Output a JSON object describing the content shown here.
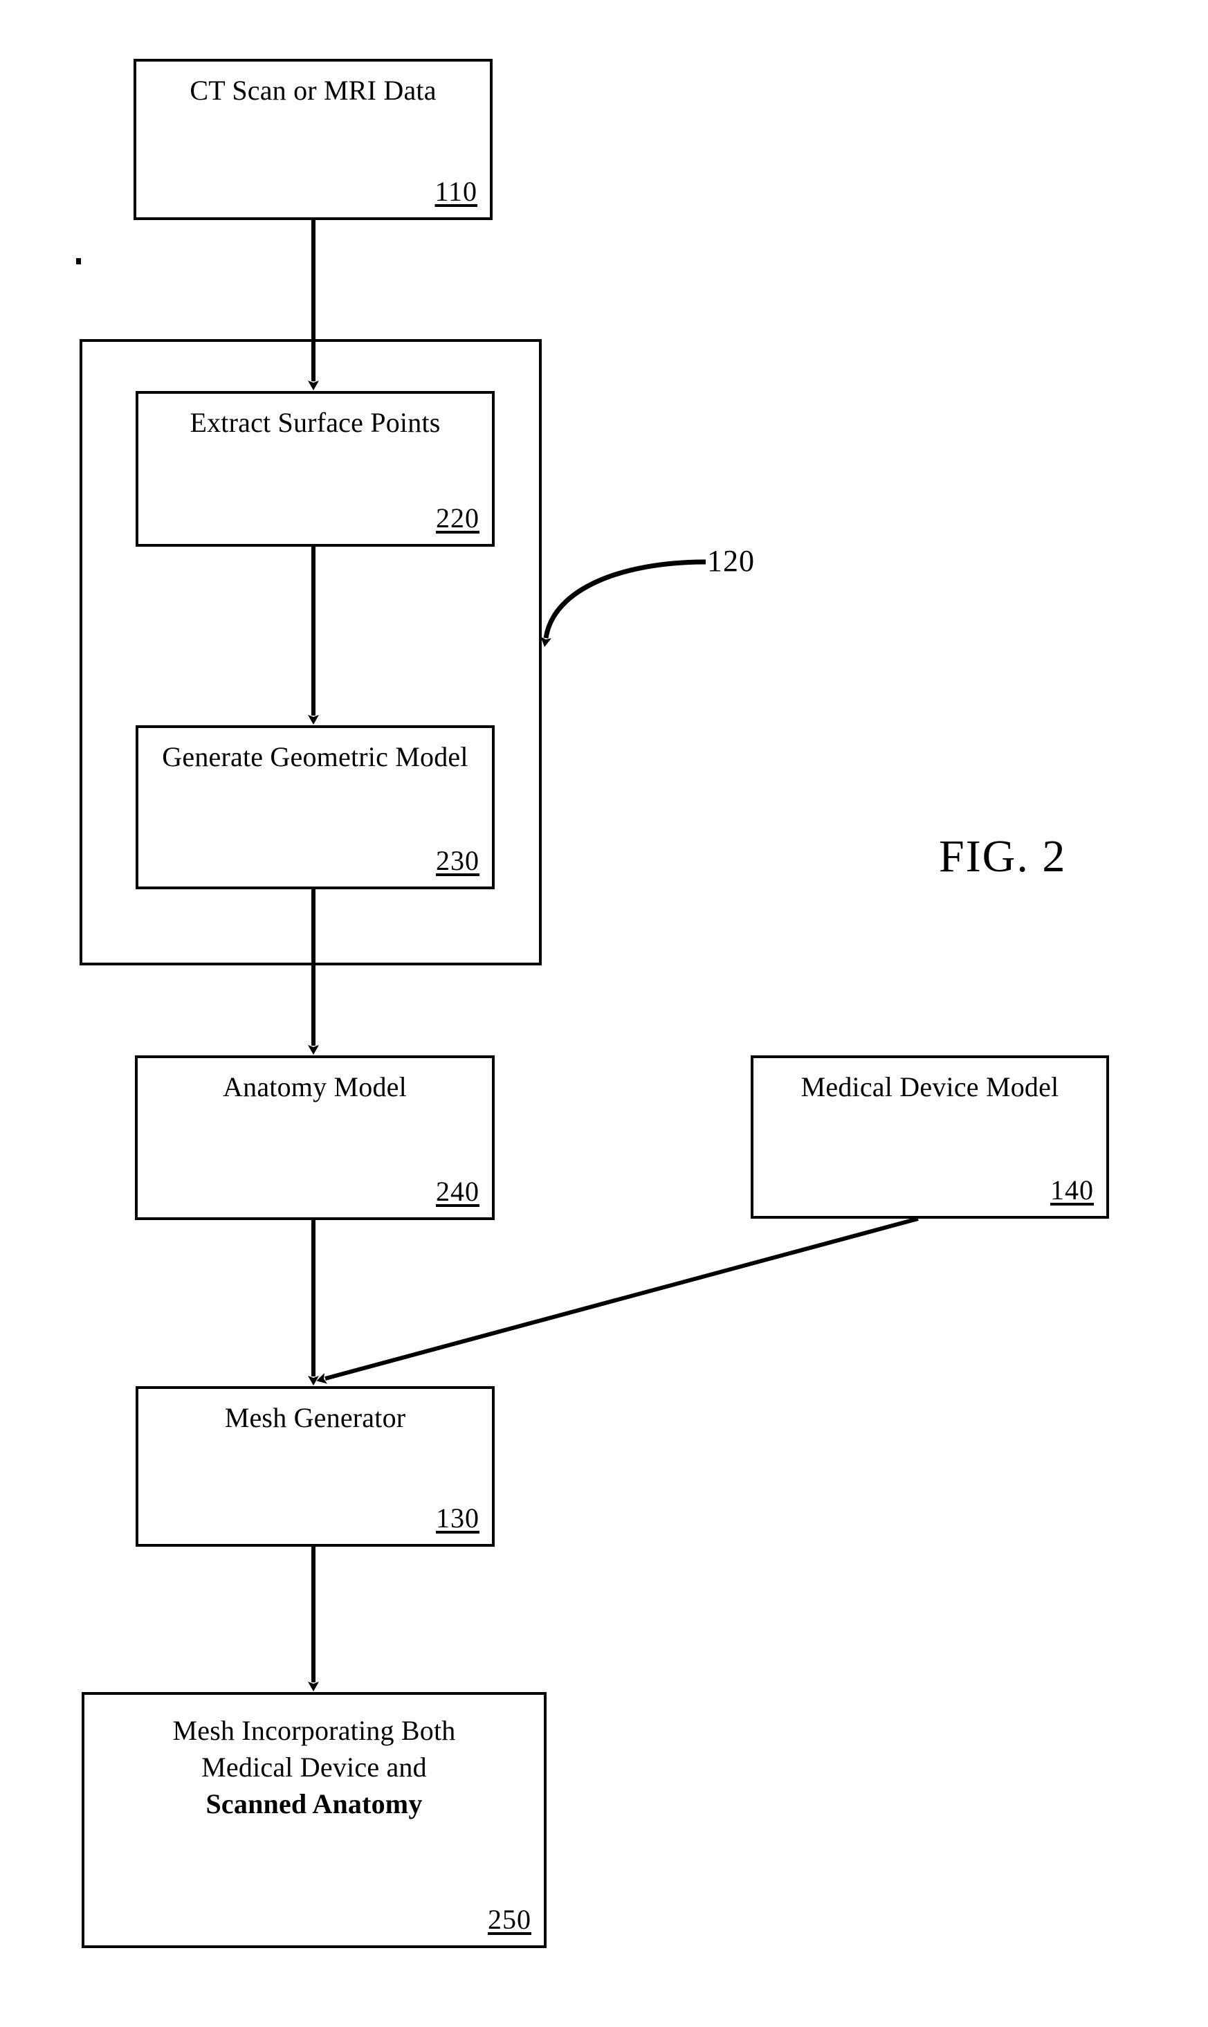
{
  "figure": {
    "label": "FIG. 2",
    "type": "patent-flowchart"
  },
  "nodes": {
    "scan_data": {
      "title": "CT Scan or MRI Data",
      "ref": "110"
    },
    "extract_points": {
      "title": "Extract Surface Points",
      "ref": "220"
    },
    "generate_model": {
      "title": "Generate Geometric Model",
      "ref": "230"
    },
    "anatomy_model": {
      "title": "Anatomy Model",
      "ref": "240"
    },
    "device_model": {
      "title": "Medical Device Model",
      "ref": "140"
    },
    "mesh_generator": {
      "title": "Mesh Generator",
      "ref": "130"
    },
    "final_mesh": {
      "line1": "Mesh Incorporating Both",
      "line2": "Medical Device and",
      "line3": "Scanned Anatomy",
      "ref": "250"
    }
  },
  "groups": {
    "process_group": {
      "ref": "120"
    }
  },
  "colors": {
    "ink": "#000000",
    "paper": "#ffffff"
  }
}
